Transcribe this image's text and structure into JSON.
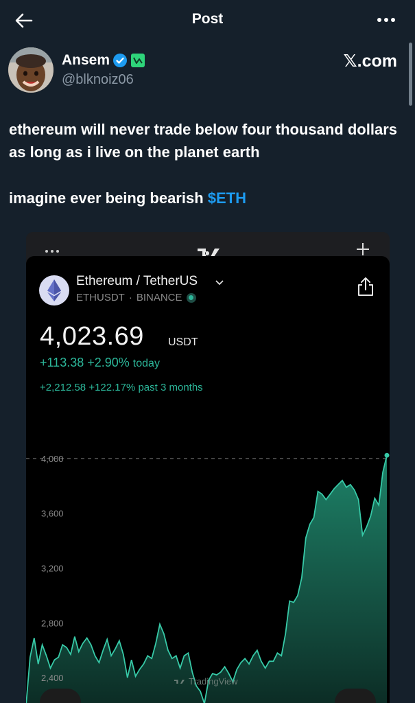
{
  "header": {
    "title": "Post"
  },
  "author": {
    "name": "Ansem",
    "handle": "@blknoiz06",
    "source": "𝕏.com",
    "verified_color": "#1d9bf0",
    "affiliate_color": "#2ed47a"
  },
  "post": {
    "line1": "ethereum will never trade below four thousand dollars as long as i live on the planet earth",
    "line2_text": "imagine ever being bearish ",
    "cashtag": "$ETH"
  },
  "media": {
    "pair": "Ethereum / TetherUS",
    "symbol": "ETHUSDT",
    "exchange": "BINANCE",
    "separator": "·",
    "price": "4,023.69",
    "currency": "USDT",
    "change_today": "+113.38 +2.90%",
    "change_today_suffix": "today",
    "change_period": "+2,212.58 +122.17% past 3 months",
    "watermark": "TradingView",
    "accent_color": "#2cb79a",
    "chart_data": {
      "type": "area",
      "series": [
        {
          "values": [
            2200,
            2550,
            2690,
            2500,
            2640,
            2560,
            2470,
            2530,
            2550,
            2640,
            2620,
            2570,
            2700,
            2590,
            2650,
            2690,
            2640,
            2560,
            2510,
            2600,
            2680,
            2560,
            2610,
            2670,
            2570,
            2400,
            2530,
            2410,
            2460,
            2500,
            2560,
            2540,
            2650,
            2790,
            2720,
            2600,
            2540,
            2560,
            2470,
            2560,
            2580,
            2440,
            2340,
            2300,
            2210,
            2380,
            2430,
            2420,
            2440,
            2480,
            2430,
            2370,
            2460,
            2510,
            2540,
            2500,
            2560,
            2600,
            2520,
            2470,
            2520,
            2520,
            2580,
            2560,
            2720,
            2960,
            2950,
            3000,
            3130,
            3420,
            3520,
            3570,
            3760,
            3740,
            3700,
            3740,
            3780,
            3810,
            3840,
            3790,
            3810,
            3770,
            3700,
            3440,
            3500,
            3580,
            3710,
            3660,
            3900,
            4023.69
          ]
        }
      ],
      "y_ticks": [
        "4,000",
        "3,600",
        "3,200",
        "2,800",
        "2,400"
      ],
      "y_tick_values": [
        4000,
        3600,
        3200,
        2800,
        2400
      ],
      "ylim": [
        2170,
        4150
      ],
      "reference_line": 4000,
      "grid": false
    }
  }
}
